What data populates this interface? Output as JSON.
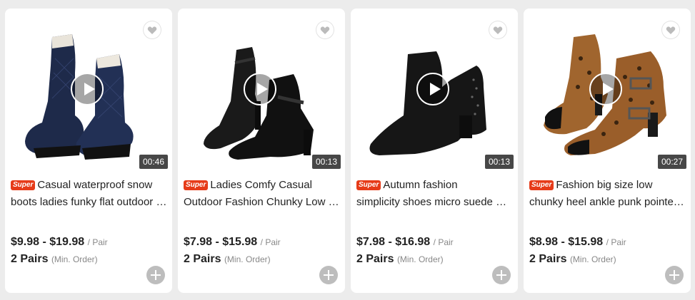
{
  "cards": [
    {
      "badge": "Super",
      "title_line1": "Casual waterproof snow",
      "title_line2": "boots ladies funky flat outdoor …",
      "price": "$9.98 - $19.98",
      "price_unit": "/ Pair",
      "moq": "2 Pairs",
      "moq_unit": "(Min. Order)",
      "duration": "00:46",
      "image_icon": "navy-snow-boots"
    },
    {
      "badge": "Super",
      "title_line1": "Ladies Comfy Casual",
      "title_line2": "Outdoor Fashion Chunky Low …",
      "price": "$7.98 - $15.98",
      "price_unit": "/ Pair",
      "moq": "2 Pairs",
      "moq_unit": "(Min. Order)",
      "duration": "00:13",
      "image_icon": "black-ankle-boots"
    },
    {
      "badge": "Super",
      "title_line1": "Autumn fashion",
      "title_line2": "simplicity shoes micro suede …",
      "price": "$7.98 - $16.98",
      "price_unit": "/ Pair",
      "moq": "2 Pairs",
      "moq_unit": "(Min. Order)",
      "duration": "00:13",
      "image_icon": "black-suede-boots"
    },
    {
      "badge": "Super",
      "title_line1": "Fashion big size low",
      "title_line2": "chunky heel ankle punk pointe…",
      "price": "$8.98 - $15.98",
      "price_unit": "/ Pair",
      "moq": "2 Pairs",
      "moq_unit": "(Min. Order)",
      "duration": "00:27",
      "image_icon": "leopard-ankle-boots"
    }
  ],
  "colors": {
    "badge": "#e63b19",
    "background": "#ececec",
    "card": "#ffffff"
  }
}
